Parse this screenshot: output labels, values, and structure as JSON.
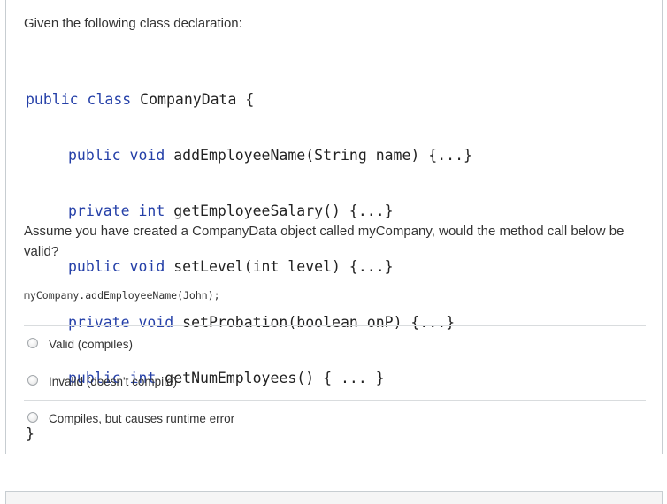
{
  "question": {
    "intro": "Given the following class declaration:",
    "code": {
      "class_open": {
        "keywords": "public class",
        "rest": " CompanyData {"
      },
      "methods": [
        {
          "keywords": "public void",
          "rest": " addEmployeeName(String name) {...}"
        },
        {
          "keywords": "private int",
          "rest": " getEmployeeSalary() {...}"
        },
        {
          "keywords": "public void",
          "rest": " setLevel(int level) {...}"
        },
        {
          "keywords": "private void",
          "rest": " setProbation(boolean onP) {...}"
        },
        {
          "keywords": "public int",
          "rest": " getNumEmployees() { ... }"
        }
      ],
      "class_close": "}"
    },
    "prompt": "Assume you have created a CompanyData object called myCompany, would the method call below be valid?",
    "method_call": "myCompany.addEmployeeName(John);",
    "answers": [
      {
        "label": "Valid (compiles)"
      },
      {
        "label": "Invalid (doesn't compile)"
      },
      {
        "label": "Compiles, but causes runtime error"
      }
    ]
  },
  "colors": {
    "keyword": "#2540a8",
    "border": "#c7cdd1",
    "text": "#333333"
  }
}
